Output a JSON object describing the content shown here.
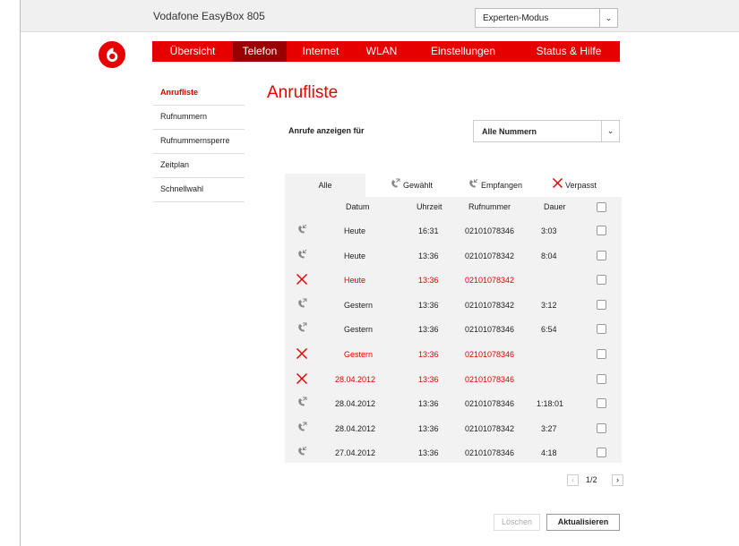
{
  "app": {
    "title": "Vodafone EasyBox 805"
  },
  "mode_select": {
    "value": "Experten-Modus"
  },
  "colors": {
    "brand": "#e60000",
    "nav_active": "#990000",
    "missed": "#e60000"
  },
  "nav": {
    "items": [
      {
        "label": "Übersicht"
      },
      {
        "label": "Telefon"
      },
      {
        "label": "Internet"
      },
      {
        "label": "WLAN"
      },
      {
        "label": "Einstellungen"
      },
      {
        "label": "Status & Hilfe"
      }
    ]
  },
  "sidebar": {
    "items": [
      {
        "label": "Anrufliste"
      },
      {
        "label": "Rufnummern"
      },
      {
        "label": "Rufnummernsperre"
      },
      {
        "label": "Zeitplan"
      },
      {
        "label": "Schnellwahl"
      }
    ]
  },
  "main": {
    "title": "Anrufliste",
    "filter_label": "Anrufe anzeigen für",
    "filter_value": "Alle Nummern"
  },
  "tabs": [
    {
      "label": "Alle",
      "icon": "none"
    },
    {
      "label": "Gewählt",
      "icon": "outgoing-call-icon"
    },
    {
      "label": "Empfangen",
      "icon": "incoming-call-icon"
    },
    {
      "label": "Verpasst",
      "icon": "missed-call-icon"
    }
  ],
  "columns": {
    "datum": "Datum",
    "uhrzeit": "Uhrzeit",
    "rufnummer": "Rufnummer",
    "dauer": "Dauer"
  },
  "rows": [
    {
      "type": "incoming",
      "datum": "Heute",
      "uhrzeit": "16:31",
      "rufnummer": "02101078346",
      "dauer": "3:03"
    },
    {
      "type": "incoming",
      "datum": "Heute",
      "uhrzeit": "13:36",
      "rufnummer": "02101078342",
      "dauer": "8:04"
    },
    {
      "type": "missed",
      "datum": "Heute",
      "uhrzeit": "13:36",
      "rufnummer": "02101078342",
      "dauer": ""
    },
    {
      "type": "outgoing",
      "datum": "Gestern",
      "uhrzeit": "13:36",
      "rufnummer": "02101078342",
      "dauer": "3:12"
    },
    {
      "type": "outgoing",
      "datum": "Gestern",
      "uhrzeit": "13:36",
      "rufnummer": "02101078346",
      "dauer": "6:54"
    },
    {
      "type": "missed",
      "datum": "Gestern",
      "uhrzeit": "13:36",
      "rufnummer": "02101078346",
      "dauer": ""
    },
    {
      "type": "missed",
      "datum": "28.04.2012",
      "uhrzeit": "13:36",
      "rufnummer": "02101078346",
      "dauer": ""
    },
    {
      "type": "outgoing",
      "datum": "28.04.2012",
      "uhrzeit": "13:36",
      "rufnummer": "02101078346",
      "dauer": "1:18:01"
    },
    {
      "type": "outgoing",
      "datum": "28.04.2012",
      "uhrzeit": "13:36",
      "rufnummer": "02101078342",
      "dauer": "3:27"
    },
    {
      "type": "incoming",
      "datum": "27.04.2012",
      "uhrzeit": "13:36",
      "rufnummer": "02101078346",
      "dauer": "4:18"
    }
  ],
  "pager": {
    "text": "1/2"
  },
  "buttons": {
    "delete": "Löschen",
    "refresh": "Aktualisieren"
  }
}
